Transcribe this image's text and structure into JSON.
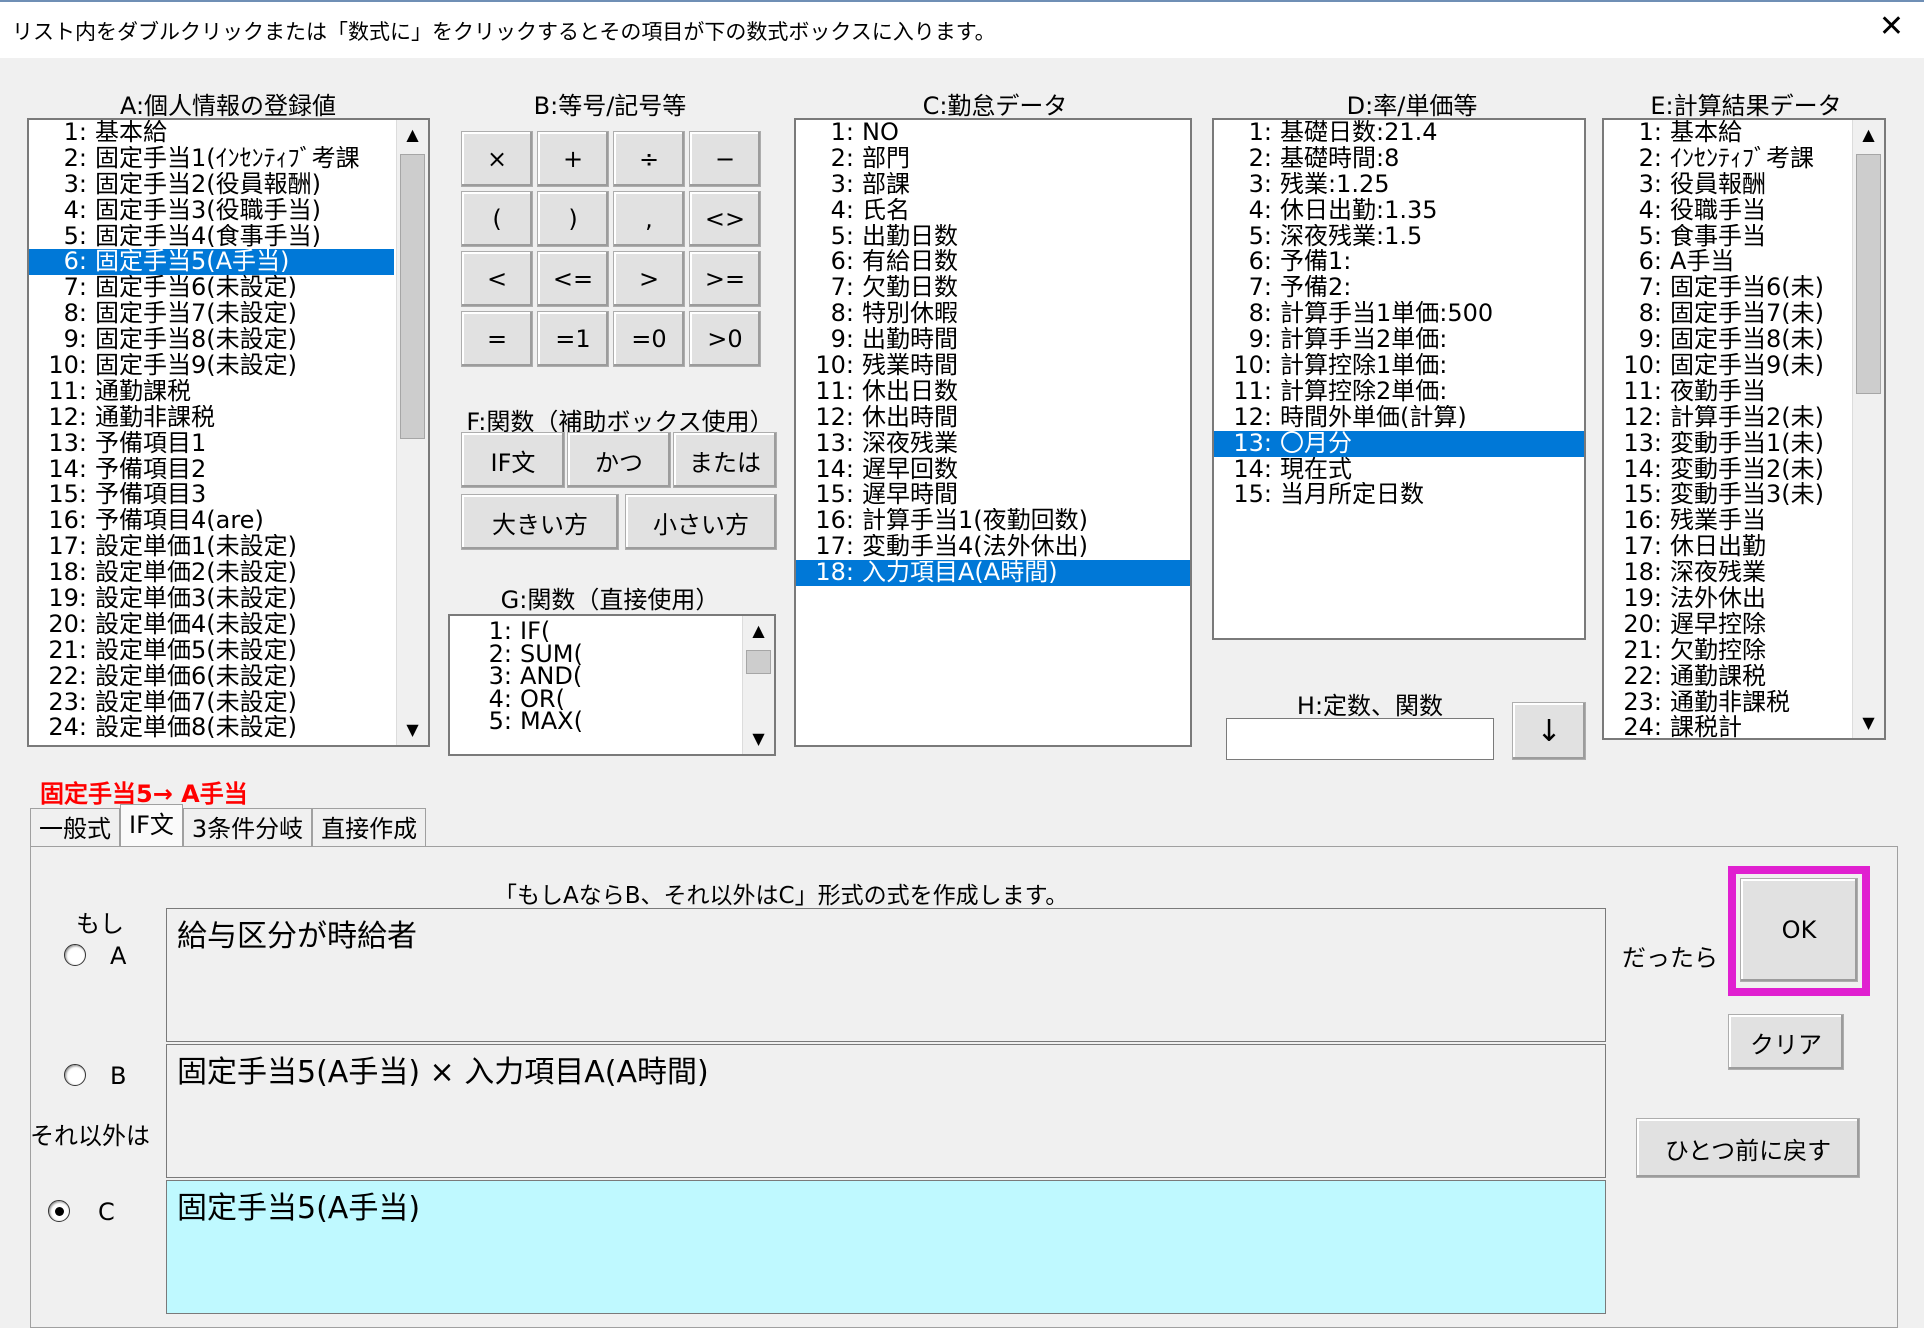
{
  "window": {
    "title": "リスト内をダブルクリックまたは「数式に」をクリックするとその項目が下の数式ボックスに入ります。",
    "close_glyph": "✕"
  },
  "list_a": {
    "caption": "A:個人情報の登録値",
    "items": [
      {
        "num": "1:",
        "label": "基本給"
      },
      {
        "num": "2:",
        "label": "固定手当1(ｲﾝｾﾝﾃｨﾌﾞ考課"
      },
      {
        "num": "3:",
        "label": "固定手当2(役員報酬)"
      },
      {
        "num": "4:",
        "label": "固定手当3(役職手当)"
      },
      {
        "num": "5:",
        "label": "固定手当4(食事手当)"
      },
      {
        "num": "6:",
        "label": "固定手当5(A手当)"
      },
      {
        "num": "7:",
        "label": "固定手当6(未設定)"
      },
      {
        "num": "8:",
        "label": "固定手当7(未設定)"
      },
      {
        "num": "9:",
        "label": "固定手当8(未設定)"
      },
      {
        "num": "10:",
        "label": "固定手当9(未設定)"
      },
      {
        "num": "11:",
        "label": "通勤課税"
      },
      {
        "num": "12:",
        "label": "通勤非課税"
      },
      {
        "num": "13:",
        "label": "予備項目1"
      },
      {
        "num": "14:",
        "label": "予備項目2"
      },
      {
        "num": "15:",
        "label": "予備項目3"
      },
      {
        "num": "16:",
        "label": "予備項目4(are)"
      },
      {
        "num": "17:",
        "label": "設定単価1(未設定)"
      },
      {
        "num": "18:",
        "label": "設定単価2(未設定)"
      },
      {
        "num": "19:",
        "label": "設定単価3(未設定)"
      },
      {
        "num": "20:",
        "label": "設定単価4(未設定)"
      },
      {
        "num": "21:",
        "label": "設定単価5(未設定)"
      },
      {
        "num": "22:",
        "label": "設定単価6(未設定)"
      },
      {
        "num": "23:",
        "label": "設定単価7(未設定)"
      },
      {
        "num": "24:",
        "label": "設定単価8(未設定)"
      }
    ],
    "selected_index": 5
  },
  "operators": {
    "caption": "B:等号/記号等",
    "buttons": [
      "×",
      "+",
      "÷",
      "−",
      "(",
      ")",
      ",",
      "<>",
      "<",
      "<=",
      ">",
      ">=",
      "=",
      "=1",
      "=0",
      ">0"
    ]
  },
  "functions_f": {
    "caption": "F:関数（補助ボックス使用）",
    "buttons": [
      "IF文",
      "かつ",
      "または",
      "大きい方",
      "小さい方"
    ]
  },
  "functions_g": {
    "caption": "G:関数（直接使用）",
    "items": [
      {
        "num": "1:",
        "label": "IF("
      },
      {
        "num": "2:",
        "label": "SUM("
      },
      {
        "num": "3:",
        "label": "AND("
      },
      {
        "num": "4:",
        "label": "OR("
      },
      {
        "num": "5:",
        "label": "MAX("
      }
    ]
  },
  "list_c": {
    "caption": "C:勤怠データ",
    "items": [
      {
        "num": "1:",
        "label": "NO"
      },
      {
        "num": "2:",
        "label": "部門"
      },
      {
        "num": "3:",
        "label": "部課"
      },
      {
        "num": "4:",
        "label": "氏名"
      },
      {
        "num": "5:",
        "label": "出勤日数"
      },
      {
        "num": "6:",
        "label": "有給日数"
      },
      {
        "num": "7:",
        "label": "欠勤日数"
      },
      {
        "num": "8:",
        "label": "特別休暇"
      },
      {
        "num": "9:",
        "label": "出勤時間"
      },
      {
        "num": "10:",
        "label": "残業時間"
      },
      {
        "num": "11:",
        "label": "休出日数"
      },
      {
        "num": "12:",
        "label": "休出時間"
      },
      {
        "num": "13:",
        "label": "深夜残業"
      },
      {
        "num": "14:",
        "label": "遅早回数"
      },
      {
        "num": "15:",
        "label": "遅早時間"
      },
      {
        "num": "16:",
        "label": "計算手当1(夜勤回数)"
      },
      {
        "num": "17:",
        "label": "変動手当4(法外休出)"
      },
      {
        "num": "18:",
        "label": "入力項目A(A時間)"
      }
    ],
    "selected_index": 17
  },
  "list_d": {
    "caption": "D:率/単価等",
    "items": [
      {
        "num": "1:",
        "label": "基礎日数:21.4"
      },
      {
        "num": "2:",
        "label": "基礎時間:8"
      },
      {
        "num": "3:",
        "label": "残業:1.25"
      },
      {
        "num": "4:",
        "label": "休日出勤:1.35"
      },
      {
        "num": "5:",
        "label": "深夜残業:1.5"
      },
      {
        "num": "6:",
        "label": "予備1:"
      },
      {
        "num": "7:",
        "label": "予備2:"
      },
      {
        "num": "8:",
        "label": "計算手当1単価:500"
      },
      {
        "num": "9:",
        "label": "計算手当2単価:"
      },
      {
        "num": "10:",
        "label": "計算控除1単価:"
      },
      {
        "num": "11:",
        "label": "計算控除2単価:"
      },
      {
        "num": "12:",
        "label": "時間外単価(計算)"
      },
      {
        "num": "13:",
        "label": "〇月分"
      },
      {
        "num": "14:",
        "label": "現在式"
      },
      {
        "num": "15:",
        "label": "当月所定日数"
      }
    ],
    "selected_index": 12
  },
  "constants_h": {
    "caption": "H:定数、関数",
    "value": "",
    "insert_button": "↓"
  },
  "list_e": {
    "caption": "E:計算結果データ",
    "items": [
      {
        "num": "1:",
        "label": "基本給"
      },
      {
        "num": "2:",
        "label": "ｲﾝｾﾝﾃｨﾌﾞ考課"
      },
      {
        "num": "3:",
        "label": "役員報酬"
      },
      {
        "num": "4:",
        "label": "役職手当"
      },
      {
        "num": "5:",
        "label": "食事手当"
      },
      {
        "num": "6:",
        "label": "A手当"
      },
      {
        "num": "7:",
        "label": "固定手当6(未)"
      },
      {
        "num": "8:",
        "label": "固定手当7(未)"
      },
      {
        "num": "9:",
        "label": "固定手当8(未)"
      },
      {
        "num": "10:",
        "label": "固定手当9(未)"
      },
      {
        "num": "11:",
        "label": "夜勤手当"
      },
      {
        "num": "12:",
        "label": "計算手当2(未)"
      },
      {
        "num": "13:",
        "label": "変動手当1(未)"
      },
      {
        "num": "14:",
        "label": "変動手当2(未)"
      },
      {
        "num": "15:",
        "label": "変動手当3(未)"
      },
      {
        "num": "16:",
        "label": "残業手当"
      },
      {
        "num": "17:",
        "label": "休日出勤"
      },
      {
        "num": "18:",
        "label": "深夜残業"
      },
      {
        "num": "19:",
        "label": "法外休出"
      },
      {
        "num": "20:",
        "label": "遅早控除"
      },
      {
        "num": "21:",
        "label": "欠勤控除"
      },
      {
        "num": "22:",
        "label": "通勤課税"
      },
      {
        "num": "23:",
        "label": "通勤非課税"
      },
      {
        "num": "24:",
        "label": "課税計"
      }
    ]
  },
  "target": {
    "label": "固定手当5→ A手当",
    "color": "#ff0000"
  },
  "tabs": [
    {
      "label": "一般式",
      "active": false
    },
    {
      "label": "IF文",
      "active": true
    },
    {
      "label": "3条件分岐",
      "active": false
    },
    {
      "label": "直接作成",
      "active": false
    }
  ],
  "if_panel": {
    "description": "「もしAならB、それ以外はC」形式の式を作成します。",
    "if_label": "もし",
    "then_label": "だったら",
    "else_label": "それ以外は",
    "option_a": "A",
    "option_b": "B",
    "option_c": "C",
    "selected_option": "C",
    "field_a": "給与区分が時給者",
    "field_b": "固定手当5(A手当) × 入力項目A(A時間)",
    "field_c": "固定手当5(A手当)",
    "field_c_color": "#bff9ff",
    "ok_button": "OK",
    "ok_highlight_color": "#e020d0",
    "clear_button": "クリア",
    "undo_button": "ひとつ前に戻す"
  }
}
